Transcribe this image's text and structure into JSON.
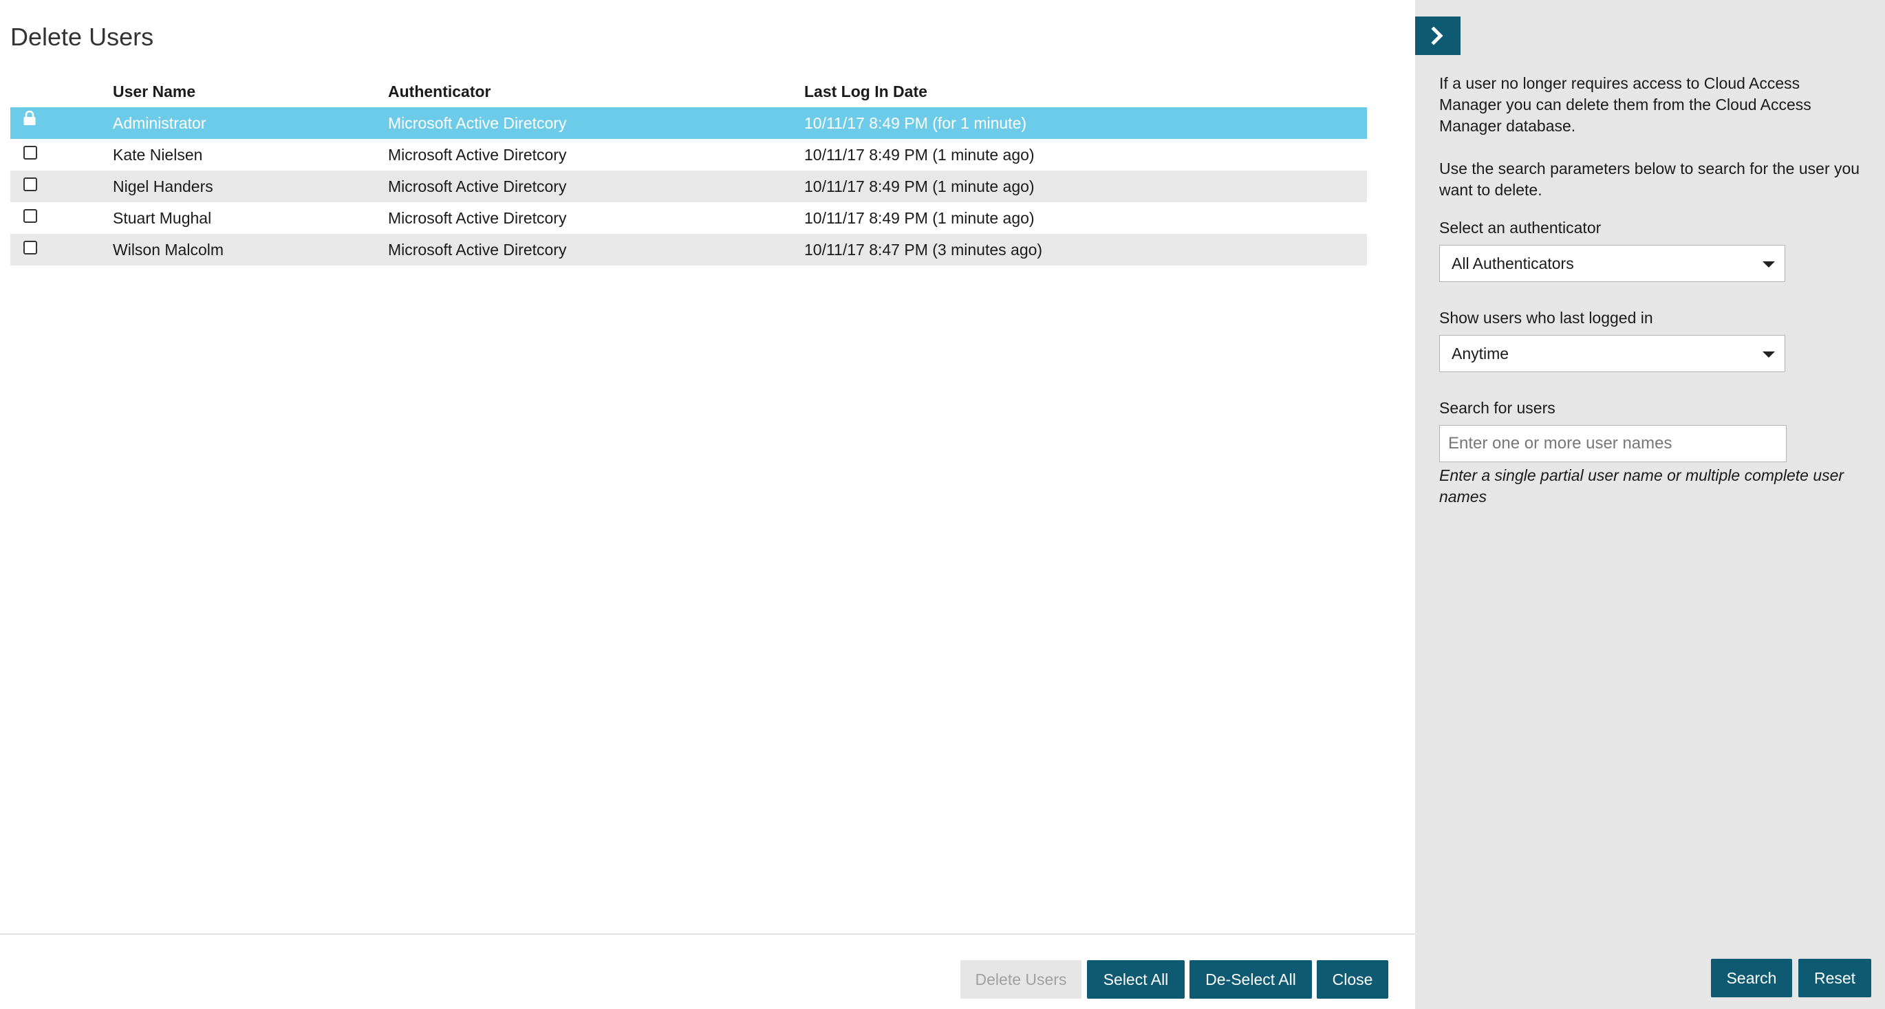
{
  "page_title": "Delete Users",
  "table": {
    "headers": {
      "user_name": "User Name",
      "authenticator": "Authenticator",
      "last_login": "Last Log In Date"
    },
    "rows": [
      {
        "user_name": "Administrator",
        "authenticator": "Microsoft Active Diretcory",
        "last_login": "10/11/17 8:49 PM (for 1 minute)",
        "state": "locked-selected"
      },
      {
        "user_name": "Kate Nielsen",
        "authenticator": "Microsoft Active Diretcory",
        "last_login": "10/11/17 8:49 PM (1 minute ago)",
        "state": "unchecked"
      },
      {
        "user_name": "Nigel Handers",
        "authenticator": "Microsoft Active Diretcory",
        "last_login": "10/11/17 8:49 PM (1 minute ago)",
        "state": "unchecked"
      },
      {
        "user_name": "Stuart Mughal",
        "authenticator": "Microsoft Active Diretcory",
        "last_login": "10/11/17 8:49 PM (1 minute ago)",
        "state": "unchecked"
      },
      {
        "user_name": "Wilson Malcolm",
        "authenticator": "Microsoft Active Diretcory",
        "last_login": "10/11/17 8:47 PM (3 minutes ago)",
        "state": "unchecked"
      }
    ]
  },
  "footer": {
    "delete_users_label": "Delete Users",
    "select_all_label": "Select All",
    "deselect_all_label": "De-Select All",
    "close_label": "Close"
  },
  "side_panel": {
    "collapse_icon": "chevron-right-icon",
    "intro_text": "If a user no longer requires access to Cloud Access Manager you can delete them from the Cloud Access Manager database.",
    "search_help_text": "Use the search parameters below to search for the user you want to delete.",
    "authenticator_label": "Select an authenticator",
    "authenticator_value": "All Authenticators",
    "last_logged_label": "Show users who last logged in",
    "last_logged_value": "Anytime",
    "search_label": "Search for users",
    "search_placeholder": "Enter one or more user names",
    "search_value": "",
    "search_hint": "Enter a single partial user name or multiple complete user names",
    "search_button_label": "Search",
    "reset_button_label": "Reset"
  },
  "colors": {
    "accent": "#0d5a72",
    "row_selected": "#6ccbe8",
    "row_alt": "#e8e8e8",
    "panel_bg": "#e6e6e6",
    "button_disabled_bg": "#e6e6e6"
  }
}
